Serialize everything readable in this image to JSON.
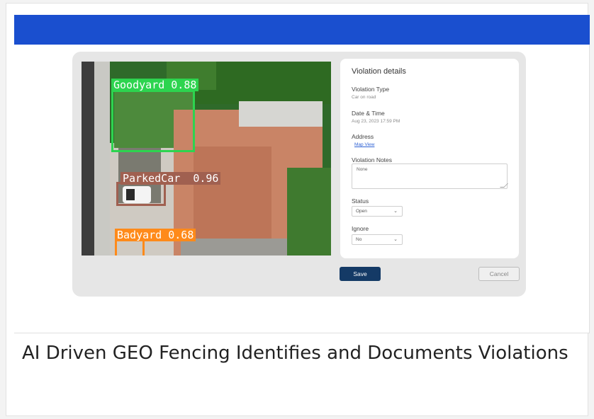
{
  "image_labels": {
    "goodyard": "Goodyard 0.88",
    "parked_car": "ParkedCar  0.96",
    "badyard": "Badyard 0.68"
  },
  "details": {
    "title": "Violation details",
    "violation_type_label": "Violation Type",
    "violation_type_value": "Car on road",
    "datetime_label": "Date & Time",
    "datetime_value": "Aug 23, 2023 17:59 PM",
    "address_label": "Address",
    "address_link": "Map View",
    "notes_label": "Violation Notes",
    "notes_value": "None",
    "status_label": "Status",
    "status_value": "Open",
    "ignore_label": "Ignore",
    "ignore_value": "No"
  },
  "buttons": {
    "save": "Save",
    "cancel": "Cancel"
  },
  "caption": "AI Driven GEO Fencing Identifies and Documents Violations",
  "colors": {
    "topbar": "#1a4fcf",
    "goodyard_box": "#2dd44f",
    "parked_car_box": "#a06050",
    "badyard_box": "#ff8a1a",
    "save_button": "#143a66"
  },
  "icons": {
    "select_chevron": "chevron-down-icon"
  }
}
